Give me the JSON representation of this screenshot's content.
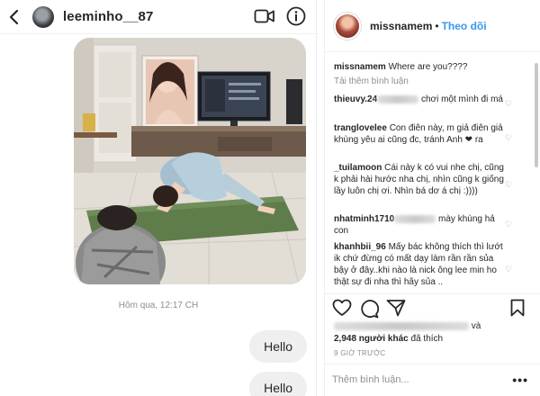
{
  "dm": {
    "username": "leeminho__87",
    "timestamp": "Hôm qua, 12:17 CH",
    "messages": [
      "Hello",
      "Hello"
    ],
    "icons": {
      "back": "back-arrow-icon",
      "video": "video-call-icon",
      "info": "info-icon"
    }
  },
  "post": {
    "username": "missnamem",
    "follow_label": "Theo dõi",
    "caption": {
      "user": "missnamem",
      "text": "Where are you????"
    },
    "load_more": "Tải thêm bình luận",
    "comments": [
      {
        "user": "thieuvy.24",
        "text": "chơi một mình đi má",
        "blurred": true
      },
      {
        "user": "tranglovelee",
        "text": "Con điên này, m giả điên giả khùng yêu ai cũng đc, tránh Anh ❤ ra",
        "blurred": false
      },
      {
        "user": "_tuilamoon",
        "text": "Cái này k có vui nhe chị, cũng k phải hài hước nha chị, nhìn cũng k giống lầy luôn chị ơi. Nhìn bá dơ á chị :))))",
        "blurred": false
      },
      {
        "user": "nhatminh1710",
        "text": "mày khùng hả con",
        "blurred": true
      },
      {
        "user": "khanhbii_96",
        "text": "Mấy bác không thích thì lướt ik chứ đừng có mất dạy làm rần rần sủa bậy ở đây..khi nào là nick ông lee min ho thật sự đi nha thì hãy sủa ..",
        "blurred": false
      }
    ],
    "likes": {
      "and": "và",
      "count_text": "2,948 người khác",
      "suffix": "đã thích"
    },
    "time_ago": "9 GIỜ TRƯỚC",
    "comment_placeholder": "Thêm bình luận...",
    "more_label": "•••"
  },
  "colors": {
    "link": "#3897f0",
    "muted": "#8e8e8e",
    "bubble": "#efefef"
  }
}
